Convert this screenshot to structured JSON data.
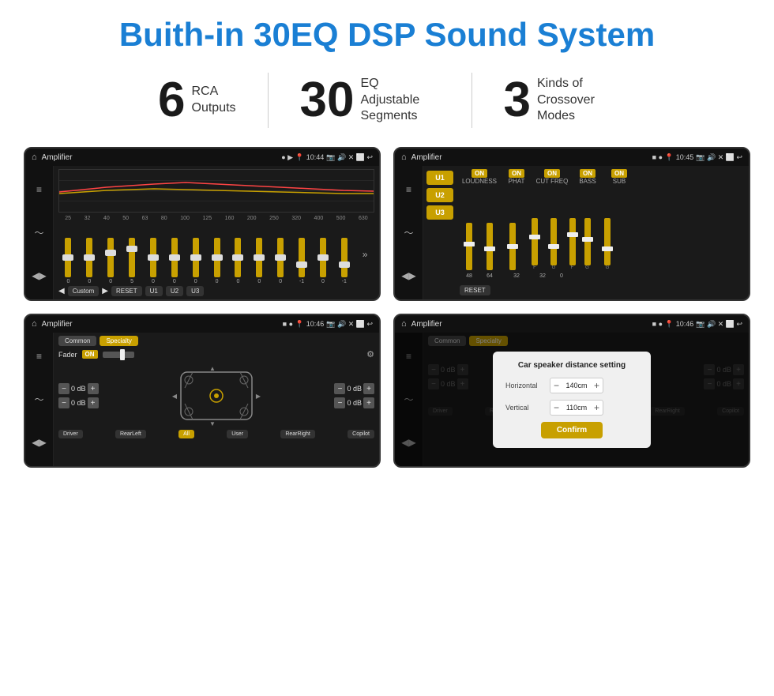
{
  "page": {
    "title": "Buith-in 30EQ DSP Sound System",
    "stats": [
      {
        "number": "6",
        "label": "RCA\nOutputs"
      },
      {
        "number": "30",
        "label": "EQ Adjustable\nSegments"
      },
      {
        "number": "3",
        "label": "Kinds of\nCrossover Modes"
      }
    ]
  },
  "screens": {
    "eq_screen": {
      "status_bar": {
        "title": "Amplifier",
        "time": "10:44"
      },
      "freq_labels": [
        "25",
        "32",
        "40",
        "50",
        "63",
        "80",
        "100",
        "125",
        "160",
        "200",
        "250",
        "320",
        "400",
        "500",
        "630"
      ],
      "slider_values": [
        "0",
        "0",
        "0",
        "5",
        "0",
        "0",
        "0",
        "0",
        "0",
        "0",
        "0",
        "-1",
        "0",
        "-1"
      ],
      "bottom_buttons": [
        "Custom",
        "RESET",
        "U1",
        "U2",
        "U3"
      ]
    },
    "crossover_screen": {
      "status_bar": {
        "title": "Amplifier",
        "time": "10:45"
      },
      "presets": [
        "U1",
        "U2",
        "U3"
      ],
      "controls": {
        "channels": [
          "LOUDNESS",
          "PHAT",
          "CUT FREQ",
          "BASS",
          "SUB"
        ],
        "on_labels": [
          "ON",
          "ON",
          "ON",
          "ON",
          "ON"
        ]
      },
      "reset_label": "RESET"
    },
    "fader_screen": {
      "status_bar": {
        "title": "Amplifier",
        "time": "10:46"
      },
      "tabs": [
        "Common",
        "Specialty"
      ],
      "fader_label": "Fader",
      "on_label": "ON",
      "speaker_values": {
        "top_left": "0 dB",
        "top_right": "0 dB",
        "bottom_left": "0 dB",
        "bottom_right": "0 dB"
      },
      "buttons": {
        "driver": "Driver",
        "rear_left": "RearLeft",
        "all": "All",
        "user": "User",
        "rear_right": "RearRight",
        "copilot": "Copilot"
      }
    },
    "distance_screen": {
      "status_bar": {
        "title": "Amplifier",
        "time": "10:46"
      },
      "tabs": [
        "Common",
        "Specialty"
      ],
      "dialog": {
        "title": "Car speaker distance setting",
        "horizontal_label": "Horizontal",
        "horizontal_value": "140cm",
        "vertical_label": "Vertical",
        "vertical_value": "110cm",
        "confirm_label": "Confirm"
      },
      "speaker_values": {
        "top_right": "0 dB",
        "bottom_right": "0 dB"
      },
      "buttons": {
        "driver": "Driver",
        "rear_left": "RearLeft",
        "all": "All",
        "user": "User",
        "rear_right": "RearRight",
        "copilot": "Copilot"
      }
    }
  }
}
